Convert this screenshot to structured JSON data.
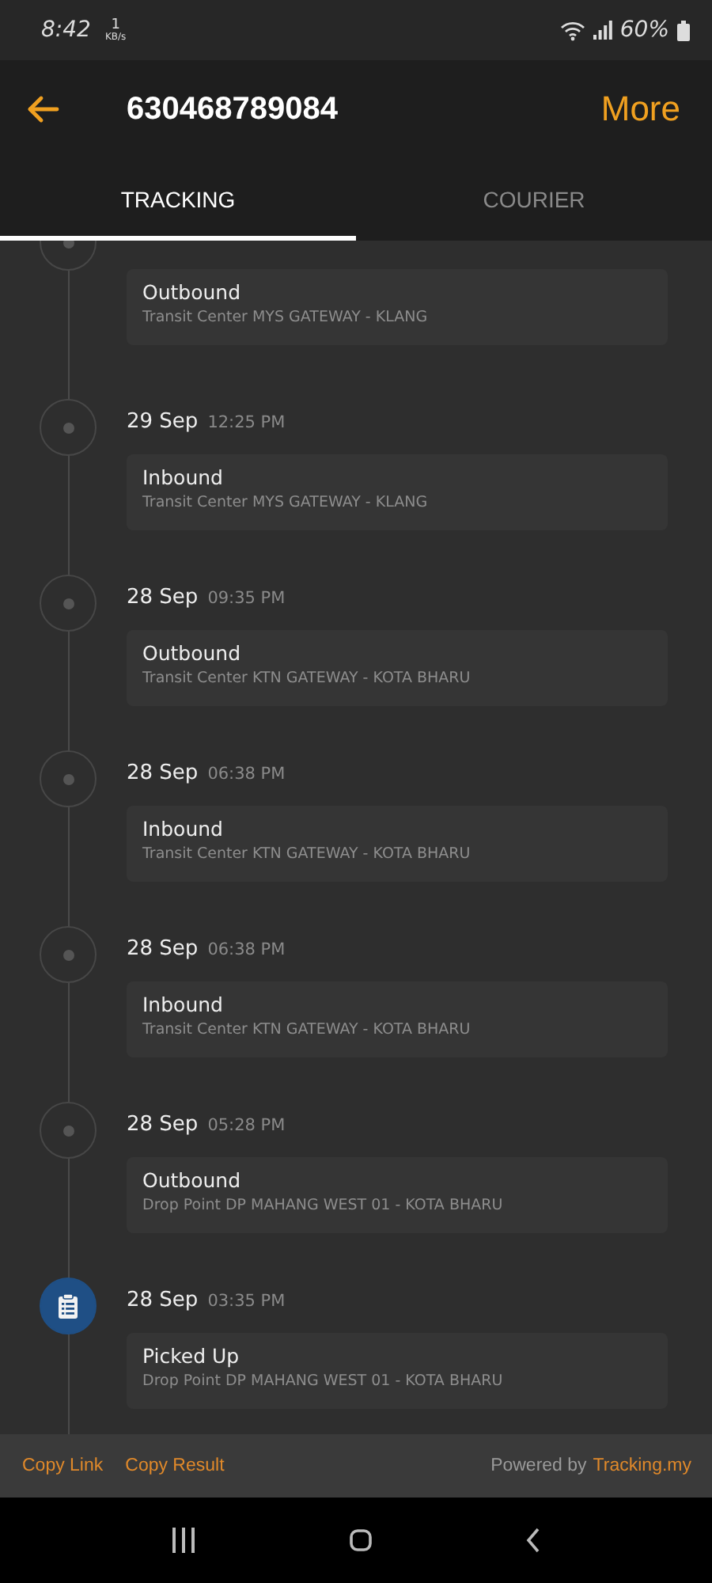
{
  "status_bar": {
    "time": "8:42",
    "speed_value": "1",
    "speed_unit": "KB/s",
    "battery": "60%"
  },
  "header": {
    "title": "630468789084",
    "more": "More"
  },
  "tabs": [
    {
      "label": "TRACKING",
      "selected": true
    },
    {
      "label": "COURIER",
      "selected": false
    }
  ],
  "events": [
    {
      "kind": "dot",
      "status": "Outbound",
      "location": "Transit Center MYS GATEWAY - KLANG"
    },
    {
      "kind": "dot",
      "date": "29 Sep",
      "time": "12:25 PM",
      "status": "Inbound",
      "location": "Transit Center MYS GATEWAY - KLANG"
    },
    {
      "kind": "dot",
      "date": "28 Sep",
      "time": "09:35 PM",
      "status": "Outbound",
      "location": "Transit Center KTN GATEWAY - KOTA BHARU"
    },
    {
      "kind": "dot",
      "date": "28 Sep",
      "time": "06:38 PM",
      "status": "Inbound",
      "location": "Transit Center KTN GATEWAY - KOTA BHARU"
    },
    {
      "kind": "dot",
      "date": "28 Sep",
      "time": "06:38 PM",
      "status": "Inbound",
      "location": "Transit Center KTN GATEWAY - KOTA BHARU"
    },
    {
      "kind": "dot",
      "date": "28 Sep",
      "time": "05:28 PM",
      "status": "Outbound",
      "location": "Drop Point DP MAHANG WEST 01 - KOTA BHARU"
    },
    {
      "kind": "clipboard",
      "date": "28 Sep",
      "time": "03:35 PM",
      "status": "Picked Up",
      "location": "Drop Point DP MAHANG WEST 01 - KOTA BHARU"
    }
  ],
  "footer": {
    "copy_link": "Copy Link",
    "copy_result": "Copy Result",
    "powered_by": "Powered by",
    "provider_link": "Tracking.my"
  }
}
